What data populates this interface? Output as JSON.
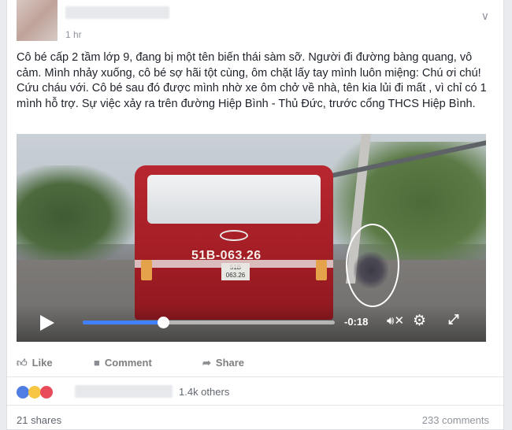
{
  "post": {
    "time": "1 hr",
    "text": "Cô bé cấp 2 tầm lớp 9, đang bị một tên biến thái sàm sỡ. Người đi đường bàng quang, vô cảm. Mình nhảy xuống, cô bé sợ hãi tột cùng, ôm chặt lấy tay mình luôn miệng: Chú ơi chú! Cứu cháu với. Cô bé sau đó được mình nhờ xe ôm chở về nhà, tên kia lủi đi mất , vì chỉ có 1 mình hỗ trợ. Sự việc xảy ra trên đường Hiệp Bình - Thủ Đức, trước cổng THCS Hiệp Bình."
  },
  "video": {
    "plate_big": "51B-063.26",
    "plate_small_line1": "51B",
    "plate_small_line2": "063.26",
    "time_remaining": "-0:18",
    "progress": 0.32
  },
  "actions": {
    "like": "Like",
    "comment": "Comment",
    "share": "Share"
  },
  "reactions": {
    "others": "1.4k others"
  },
  "stats": {
    "shares": "21 shares",
    "comments": "233 comments"
  },
  "colors": {
    "accent": "#4080ff",
    "bus_red": "#a31d25"
  }
}
